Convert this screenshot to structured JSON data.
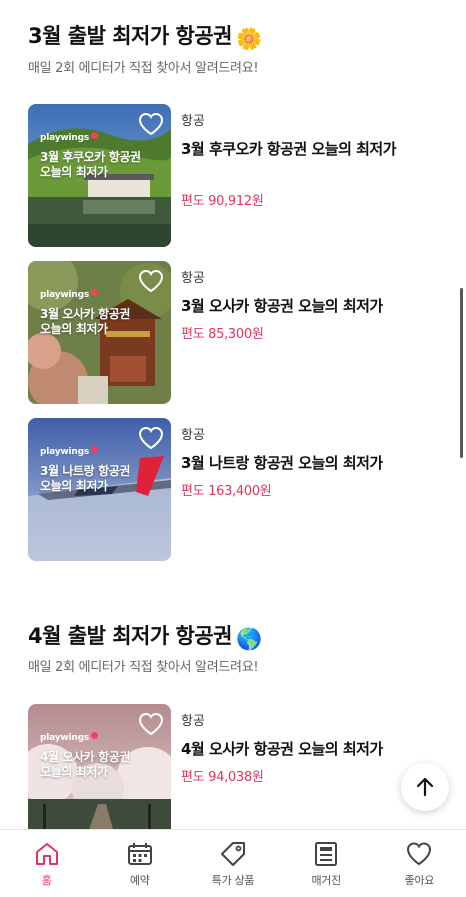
{
  "sections": [
    {
      "title": "3월 출발 최저가 항공권",
      "emoji": "🌼",
      "subtitle": "매일 2회 에디터가 직접 찾아서 알려드려요!",
      "items": [
        {
          "brand": "playwings",
          "overlay_line1": "3월 후쿠오카 항공권",
          "overlay_line2": "오늘의 최저가",
          "category": "항공",
          "name": "3월 후쿠오카 항공권 오늘의 최저가",
          "price": "편도 90,912원"
        },
        {
          "brand": "playwings",
          "overlay_line1": "3월 오사카 항공권",
          "overlay_line2": "오늘의 최저가",
          "category": "항공",
          "name": "3월 오사카 항공권 오늘의 최저가",
          "price": "편도 85,300원"
        },
        {
          "brand": "playwings",
          "overlay_line1": "3월 나트랑 항공권",
          "overlay_line2": "오늘의 최저가",
          "category": "항공",
          "name": "3월 나트랑 항공권 오늘의 최저가",
          "price": "편도 163,400원"
        }
      ]
    },
    {
      "title": "4월 출발 최저가 항공권",
      "emoji": "🌎",
      "subtitle": "매일 2회 에디터가 직접 찾아서 알려드려요!",
      "items": [
        {
          "brand": "playwings",
          "overlay_line1": "4월 오사카 항공권",
          "overlay_line2": "오늘의 최저가",
          "category": "항공",
          "name": "4월 오사카 항공권 오늘의 최저가",
          "price": "편도 94,038원"
        }
      ]
    }
  ],
  "colors": {
    "accent": "#e0365a",
    "brand_dot": "#ff3b5c"
  },
  "scroll_top_icon": "arrow-up-icon",
  "tabs": [
    {
      "label": "홈",
      "icon": "home-icon",
      "active": true
    },
    {
      "label": "예약",
      "icon": "calendar-icon",
      "active": false
    },
    {
      "label": "특가 상품",
      "icon": "tag-icon",
      "active": false
    },
    {
      "label": "매거진",
      "icon": "newspaper-icon",
      "active": false
    },
    {
      "label": "좋아요",
      "icon": "heart-icon",
      "active": false
    }
  ]
}
